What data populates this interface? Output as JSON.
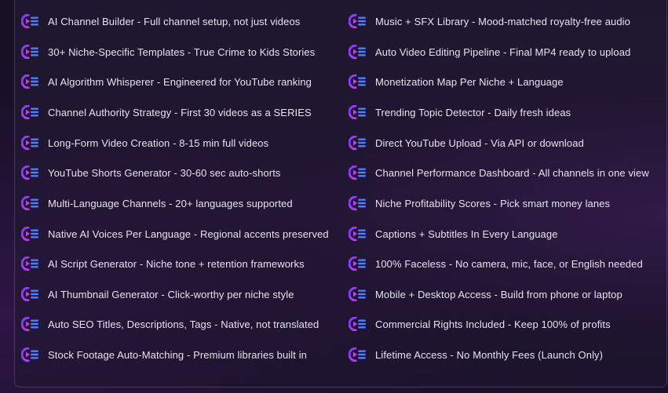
{
  "features": {
    "left": [
      {
        "label": "AI Channel Builder - Full channel setup, not just videos",
        "icon": "play-list-icon"
      },
      {
        "label": "30+ Niche-Specific Templates - True Crime to Kids Stories",
        "icon": "play-list-icon"
      },
      {
        "label": "AI Algorithm Whisperer - Engineered for YouTube ranking",
        "icon": "play-list-icon"
      },
      {
        "label": "Channel Authority Strategy - First 30 videos as a SERIES",
        "icon": "play-list-icon"
      },
      {
        "label": "Long-Form Video Creation - 8-15 min full videos",
        "icon": "play-list-icon"
      },
      {
        "label": "YouTube Shorts Generator - 30-60 sec auto-shorts",
        "icon": "play-list-icon"
      },
      {
        "label": "Multi-Language Channels - 20+ languages supported",
        "icon": "play-list-icon"
      },
      {
        "label": "Native AI Voices Per Language - Regional accents preserved",
        "icon": "play-list-icon"
      },
      {
        "label": "AI Script Generator - Niche tone + retention frameworks",
        "icon": "play-list-icon"
      },
      {
        "label": "AI Thumbnail Generator - Click-worthy per niche style",
        "icon": "play-list-icon"
      },
      {
        "label": "Auto SEO Titles, Descriptions, Tags - Native, not translated",
        "icon": "play-list-icon"
      },
      {
        "label": "Stock Footage Auto-Matching - Premium libraries built in",
        "icon": "play-list-icon"
      }
    ],
    "right": [
      {
        "label": "Music + SFX Library - Mood-matched royalty-free audio",
        "icon": "play-list-icon"
      },
      {
        "label": "Auto Video Editing Pipeline - Final MP4 ready to upload",
        "icon": "play-list-icon"
      },
      {
        "label": "Monetization Map Per Niche + Language",
        "icon": "play-list-icon"
      },
      {
        "label": "Trending Topic Detector - Daily fresh ideas",
        "icon": "play-list-icon"
      },
      {
        "label": "Direct YouTube Upload - Via API or download",
        "icon": "play-list-icon"
      },
      {
        "label": "Channel Performance Dashboard - All channels in one view",
        "icon": "play-list-icon"
      },
      {
        "label": "Niche Profitability Scores - Pick smart money lanes",
        "icon": "play-list-icon"
      },
      {
        "label": "Captions + Subtitles In Every Language",
        "icon": "play-list-icon"
      },
      {
        "label": "100% Faceless - No camera, mic, face, or English needed",
        "icon": "play-list-icon"
      },
      {
        "label": "Mobile + Desktop Access - Build from phone or laptop",
        "icon": "play-list-icon"
      },
      {
        "label": "Commercial Rights Included - Keep 100% of profits",
        "icon": "play-list-icon"
      },
      {
        "label": "Lifetime Access - No Monthly Fees (Launch Only)",
        "icon": "play-list-icon"
      }
    ]
  },
  "colors": {
    "icon_gradient_start": "#7a3cff",
    "icon_gradient_end": "#c43cf0",
    "icon_lines": "#4f7dff",
    "text": "#e7e3ee"
  }
}
